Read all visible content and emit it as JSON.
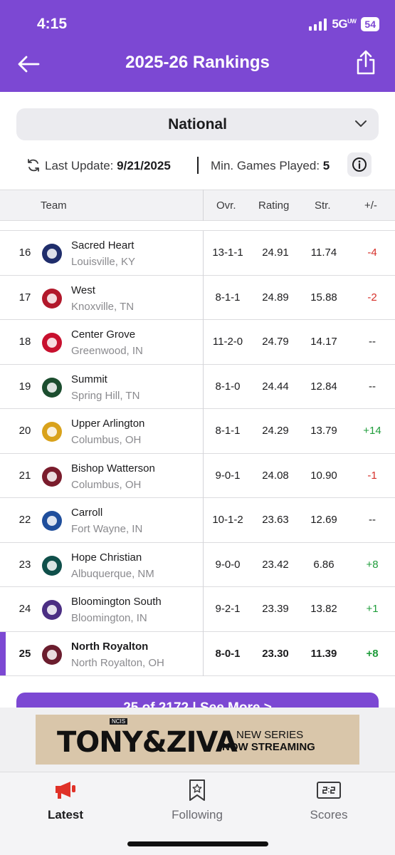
{
  "status": {
    "time": "4:15",
    "network": "5G",
    "network_suffix": "UW",
    "battery": "54"
  },
  "header": {
    "title": "2025-26 Rankings",
    "back_icon": "back-arrow-icon",
    "share_icon": "share-icon"
  },
  "filter": {
    "selected": "National"
  },
  "meta": {
    "last_update_label": "Last Update:",
    "last_update_value": "9/21/2025",
    "min_games_label": "Min. Games Played:",
    "min_games_value": "5"
  },
  "table": {
    "columns": {
      "team": "Team",
      "overall": "Ovr.",
      "rating": "Rating",
      "strength": "Str.",
      "change": "+/-"
    },
    "rows": [
      {
        "rank": "16",
        "name": "Sacred Heart",
        "location": "Louisville, KY",
        "overall": "13-1-1",
        "rating": "24.91",
        "strength": "11.74",
        "change": "-4",
        "trend": "neg",
        "logo": "viking-helmet-logo"
      },
      {
        "rank": "17",
        "name": "West",
        "location": "Knoxville, TN",
        "overall": "8-1-1",
        "rating": "24.89",
        "strength": "15.88",
        "change": "-2",
        "trend": "neg",
        "logo": "w-oval-logo"
      },
      {
        "rank": "18",
        "name": "Center Grove",
        "location": "Greenwood, IN",
        "overall": "11-2-0",
        "rating": "24.79",
        "strength": "14.17",
        "change": "--",
        "trend": "none",
        "logo": "trojan-logo"
      },
      {
        "rank": "19",
        "name": "Summit",
        "location": "Spring Hill, TN",
        "overall": "8-1-0",
        "rating": "24.44",
        "strength": "12.84",
        "change": "--",
        "trend": "none",
        "logo": "spartan-logo"
      },
      {
        "rank": "20",
        "name": "Upper Arlington",
        "location": "Columbus, OH",
        "overall": "8-1-1",
        "rating": "24.29",
        "strength": "13.79",
        "change": "+14",
        "trend": "pos",
        "logo": "bear-logo"
      },
      {
        "rank": "21",
        "name": "Bishop Watterson",
        "location": "Columbus, OH",
        "overall": "9-0-1",
        "rating": "24.08",
        "strength": "10.90",
        "change": "-1",
        "trend": "neg",
        "logo": "bw-eagles-logo"
      },
      {
        "rank": "22",
        "name": "Carroll",
        "location": "Fort Wayne, IN",
        "overall": "10-1-2",
        "rating": "23.63",
        "strength": "12.69",
        "change": "--",
        "trend": "none",
        "logo": "charger-logo"
      },
      {
        "rank": "23",
        "name": "Hope Christian",
        "location": "Albuquerque, NM",
        "overall": "9-0-0",
        "rating": "23.42",
        "strength": "6.86",
        "change": "+8",
        "trend": "pos",
        "logo": "husky-logo"
      },
      {
        "rank": "24",
        "name": "Bloomington South",
        "location": "Bloomington, IN",
        "overall": "9-2-1",
        "rating": "23.39",
        "strength": "13.82",
        "change": "+1",
        "trend": "pos",
        "logo": "panther-logo"
      },
      {
        "rank": "25",
        "name": "North Royalton",
        "location": "North Royalton, OH",
        "overall": "8-0-1",
        "rating": "23.30",
        "strength": "11.39",
        "change": "+8",
        "trend": "pos",
        "logo": "bear-maroon-logo",
        "highlighted": true
      }
    ]
  },
  "see_more": {
    "label": "25 of 2172 | See More >"
  },
  "ad": {
    "badge": "NCIS",
    "brand": "TONY&ZIVA",
    "line1": "NEW SERIES",
    "line2": "NOW STREAMING"
  },
  "tabs": [
    {
      "label": "Latest",
      "icon": "megaphone-icon",
      "active": true
    },
    {
      "label": "Following",
      "icon": "bookmark-star-icon",
      "active": false
    },
    {
      "label": "Scores",
      "icon": "scoreboard-icon",
      "active": false
    }
  ],
  "colors": {
    "brand": "#7c48d3",
    "positive": "#1f9d3b",
    "negative": "#d6302a"
  }
}
